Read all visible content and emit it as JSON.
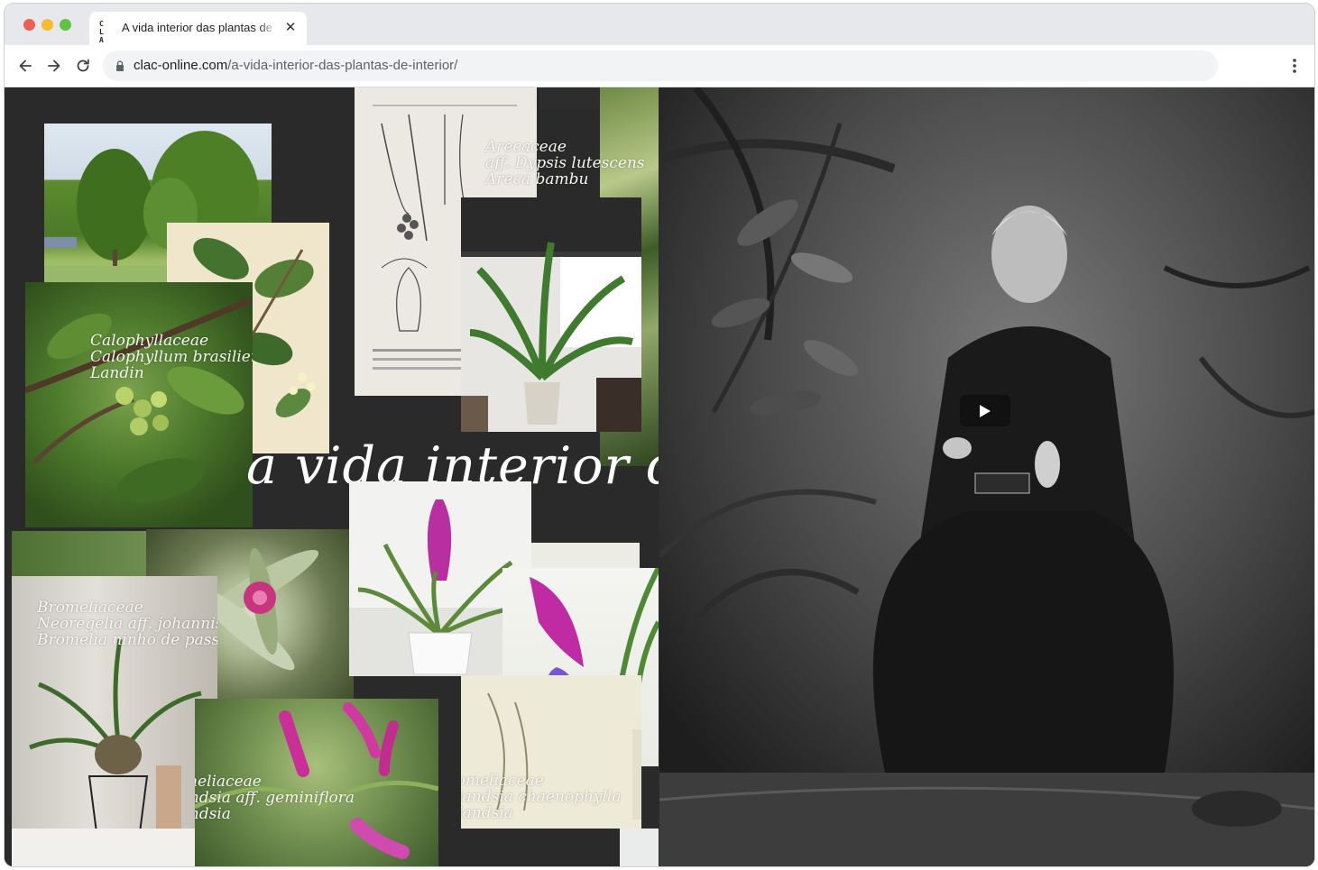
{
  "browser": {
    "tab": {
      "favicon_text": "C L A C",
      "title": "A vida interior das plantas de interior",
      "close_glyph": "✕"
    },
    "address": {
      "domain": "clac-online.com",
      "path": "/a-vida-interior-das-plantas-de-interior/"
    },
    "icons": [
      "back-arrow-icon",
      "forward-arrow-icon",
      "reload-icon",
      "lock-icon",
      "kebab-menu-icon"
    ]
  },
  "page": {
    "headline": "a vida interior das",
    "captions": {
      "arecaceae": [
        "Arecaceae",
        "aff. Dypsis lutescens",
        "Areca bambu"
      ],
      "calophyllaceae": [
        "Calophyllaceae",
        "Calophyllum brasiliense",
        "Landin"
      ],
      "bromeliaceae_neoregelia": [
        "Bromeliaceae",
        "Neoregelia aff. johannis",
        "Bromelia ninho de passarinho"
      ],
      "bromeliaceae_geminiflora": [
        "Bromeliaceae",
        "Tillandsia aff. geminiflora",
        "Tillandsia"
      ],
      "bromeliaceae_chaenophylla": [
        "Bromeliaceae",
        "Tillandsia chaenophylla",
        "Tillandsia"
      ]
    },
    "video": {
      "play_icon": "play-icon"
    }
  },
  "colors": {
    "background": "#2a2a2a",
    "caption": "#f7f7f2",
    "bromeliad_pink": "#c8357f"
  }
}
